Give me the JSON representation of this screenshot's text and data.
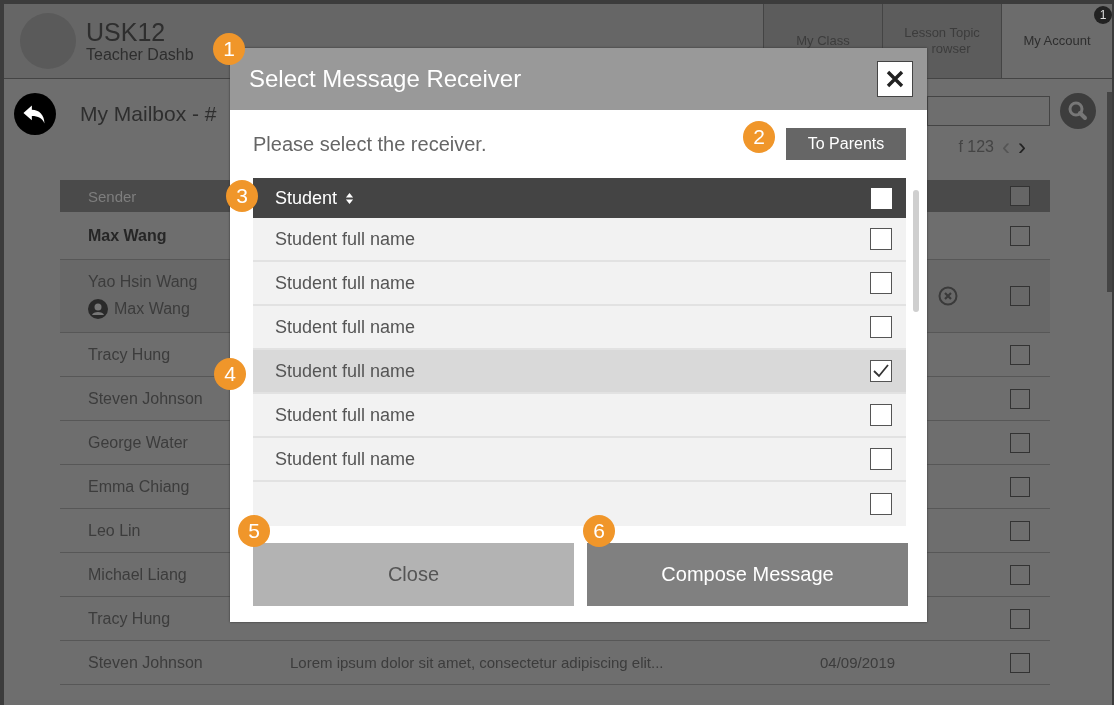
{
  "header": {
    "title": "USK12",
    "subtitle": "Teacher Dashb",
    "tabs": [
      {
        "lines": [
          "My Class"
        ],
        "selected": false
      },
      {
        "lines": [
          "Lesson Topic",
          "rowser"
        ],
        "selected": false
      },
      {
        "lines": [
          "My Account"
        ],
        "selected": true,
        "badge": "1"
      }
    ]
  },
  "mailbox": {
    "title": "My Mailbox - #",
    "pagination": "f 123",
    "prev": "‹",
    "next": "›",
    "table": {
      "column_sender": "Sender",
      "select_all_checked": false,
      "rows": [
        {
          "sender": "Max Wang",
          "unread": true,
          "checked": false
        },
        {
          "sender": "Yao Hsin Wang",
          "unread": false,
          "delegate": "Max Wang",
          "highlighted": true,
          "removable": true,
          "checked": false
        },
        {
          "sender": "Tracy Hung",
          "unread": false,
          "checked": false
        },
        {
          "sender": "Steven Johnson",
          "unread": false,
          "checked": false
        },
        {
          "sender": "George Water",
          "unread": false,
          "checked": false
        },
        {
          "sender": "Emma Chiang",
          "unread": false,
          "checked": false
        },
        {
          "sender": "Leo Lin",
          "unread": false,
          "checked": false
        },
        {
          "sender": "Michael Liang",
          "unread": false,
          "checked": false
        },
        {
          "sender": "Tracy Hung",
          "unread": false,
          "checked": false
        },
        {
          "sender": "Steven Johnson",
          "unread": false,
          "subject": "Lorem ipsum dolor sit amet, consectetur adipiscing elit...",
          "date": "04/09/2019",
          "checked": false
        }
      ]
    }
  },
  "dialog": {
    "title": "Select Message Receiver",
    "prompt": "Please select the receiver.",
    "to_parents": "To Parents",
    "column": "Student",
    "select_all_checked": false,
    "rows": [
      {
        "name": "Student full name",
        "selected": false,
        "checked": false
      },
      {
        "name": "Student full name",
        "selected": false,
        "checked": false
      },
      {
        "name": "Student full name",
        "selected": false,
        "checked": false
      },
      {
        "name": "Student full name",
        "selected": true,
        "checked": true
      },
      {
        "name": "Student full name",
        "selected": false,
        "checked": false
      },
      {
        "name": "Student full name",
        "selected": false,
        "checked": false
      },
      {
        "selected": false,
        "checked": false
      }
    ],
    "buttons": [
      {
        "label": "Close",
        "kind": "secondary"
      },
      {
        "label": "Compose Message",
        "kind": "primary"
      }
    ]
  },
  "callouts": [
    "1",
    "2",
    "3",
    "4",
    "5",
    "6"
  ]
}
